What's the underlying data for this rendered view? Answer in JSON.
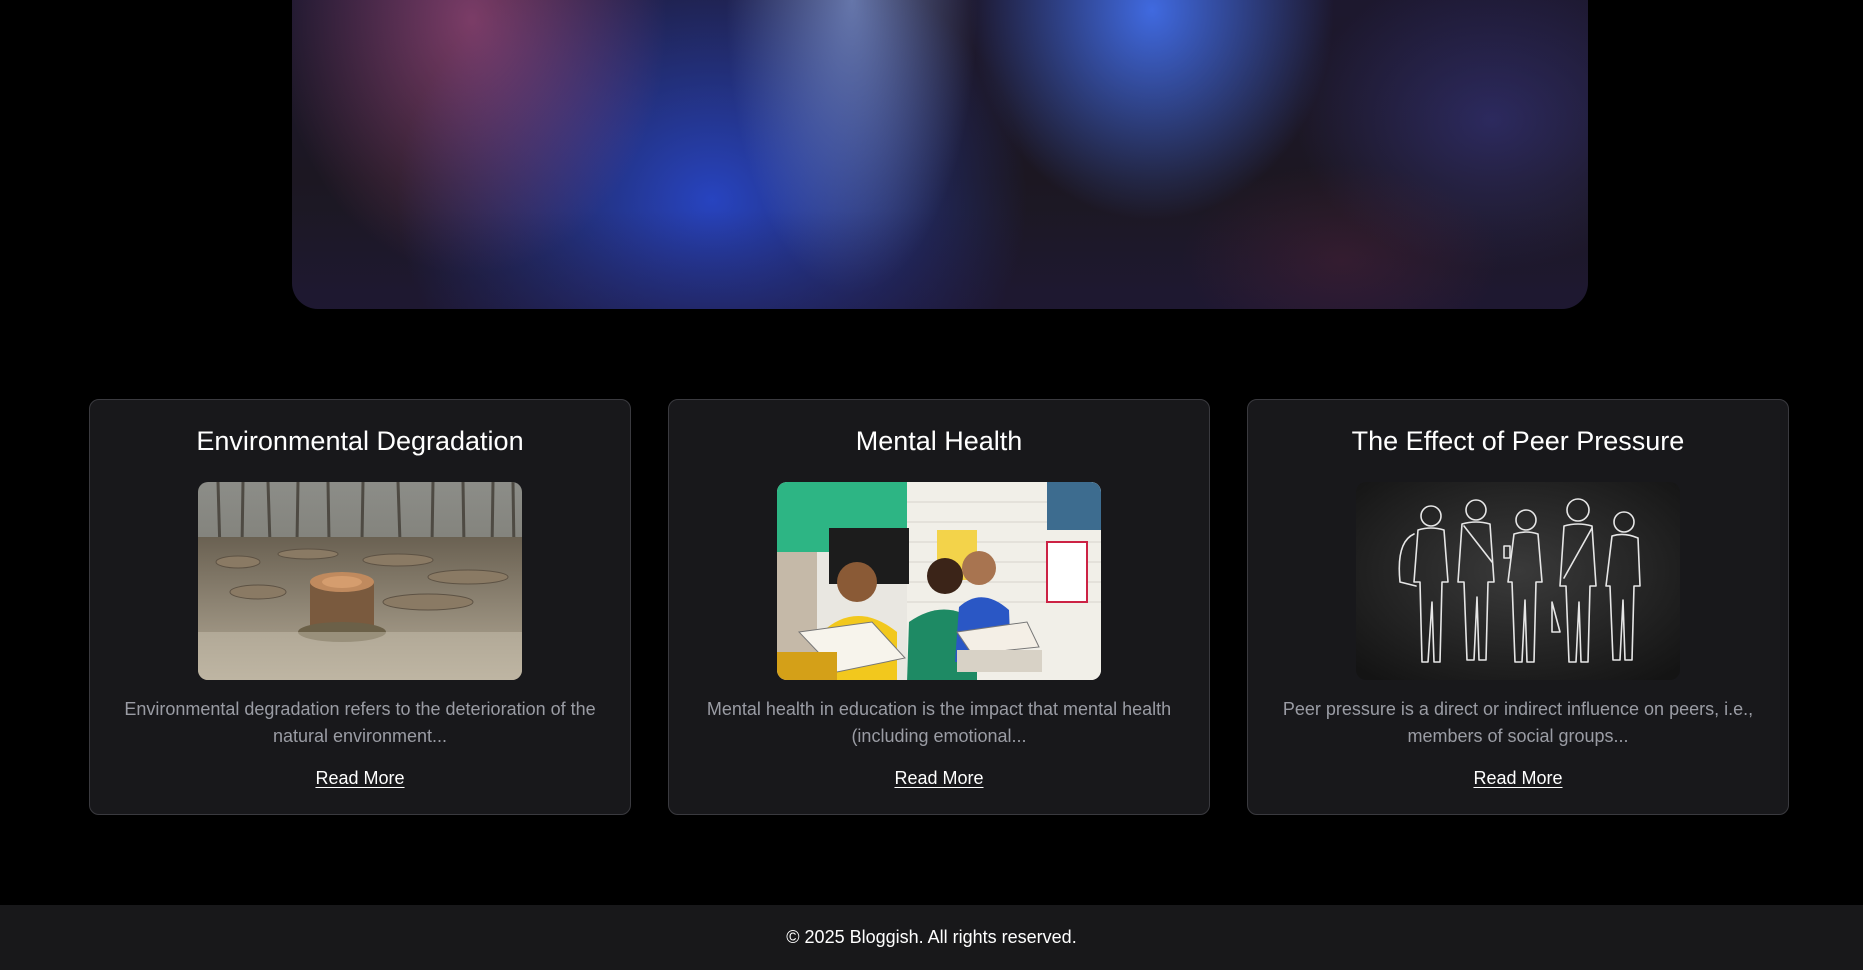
{
  "posts": [
    {
      "title": "Environmental Degradation",
      "image_alt": "tree stumps in a cleared forest",
      "excerpt": "Environmental degradation refers to the deterioration of the natural environment...",
      "link_label": "Read More"
    },
    {
      "title": "Mental Health",
      "image_alt": "children reading books in a classroom",
      "excerpt": "Mental health in education is the impact that mental health (including emotional...",
      "link_label": "Read More"
    },
    {
      "title": "The Effect of Peer Pressure",
      "image_alt": "chalk outline silhouettes of a group of people",
      "excerpt": "Peer pressure is a direct or indirect influence on peers, i.e., members of social groups...",
      "link_label": "Read More"
    }
  ],
  "footer": {
    "copyright": "© 2025 Bloggish. All rights reserved."
  },
  "colors": {
    "background": "#000000",
    "card_background": "#18181b",
    "card_border": "#3a3a3f",
    "excerpt_text": "#9a9ca4",
    "footer_background": "#18181a"
  }
}
